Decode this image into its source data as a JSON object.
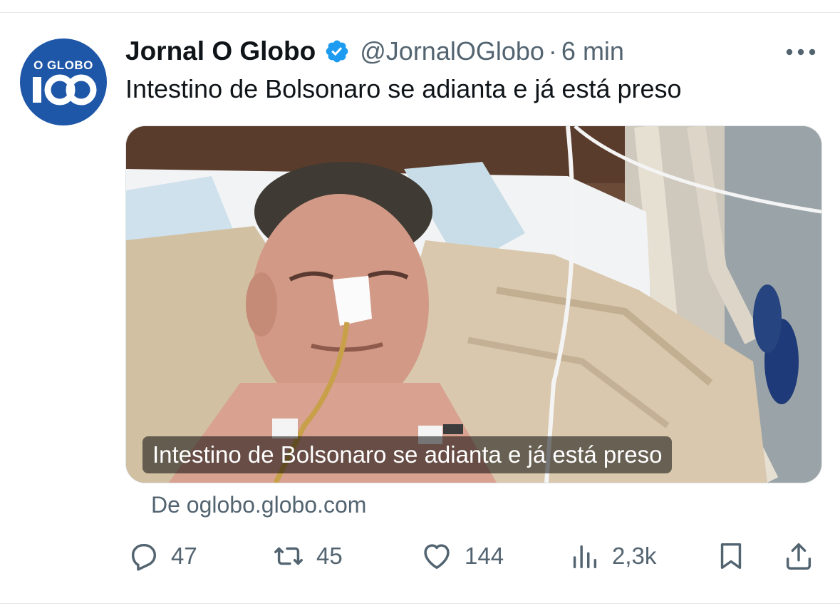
{
  "tweet": {
    "author": {
      "name": "Jornal O Globo",
      "handle": "@JornalOGlobo",
      "verified": true,
      "avatar": {
        "logo_text": "O GLOBO",
        "logo_number": "100",
        "color": "#1f57a8"
      }
    },
    "separator": "·",
    "time": "6 min",
    "more_icon": "more-horizontal-icon",
    "text": "Intestino de Bolsonaro se adianta e já está preso",
    "card": {
      "caption": "Intestino de Bolsonaro se adianta e já está preso",
      "source": "De oglobo.globo.com"
    },
    "actions": {
      "replies": "47",
      "retweets": "45",
      "likes": "144",
      "views": "2,3k"
    }
  },
  "colors": {
    "text_primary": "#0f1419",
    "text_secondary": "#536471",
    "verified_blue": "#1d9bf0"
  }
}
